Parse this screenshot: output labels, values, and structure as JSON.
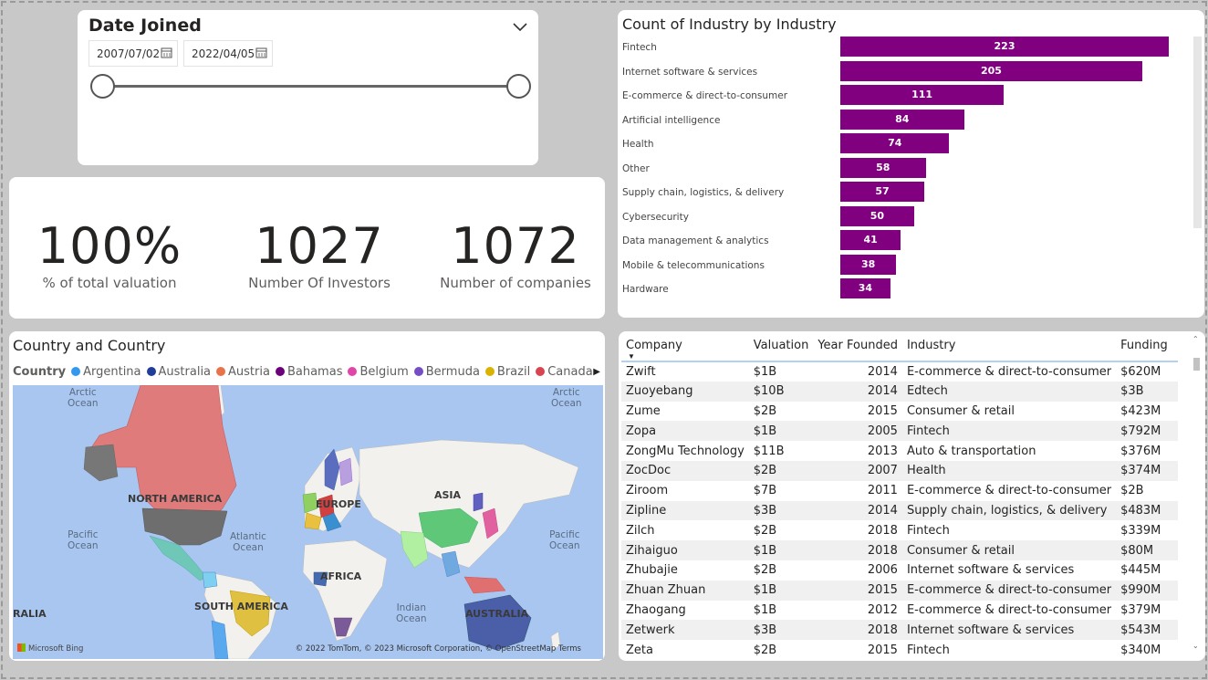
{
  "slicer": {
    "title": "Date Joined",
    "start_date": "2007/07/02",
    "end_date": "2022/04/05"
  },
  "kpis": [
    {
      "value": "100%",
      "label": "% of total valuation"
    },
    {
      "value": "1027",
      "label": "Number Of Investors"
    },
    {
      "value": "1072",
      "label": "Number of companies"
    }
  ],
  "chart_data": {
    "type": "bar",
    "orientation": "horizontal",
    "title": "Count of Industry by Industry",
    "categories": [
      "Fintech",
      "Internet software & services",
      "E-commerce & direct-to-consumer",
      "Artificial intelligence",
      "Health",
      "Other",
      "Supply chain, logistics, & delivery",
      "Cybersecurity",
      "Data management & analytics",
      "Mobile & telecommunications",
      "Hardware"
    ],
    "values": [
      223,
      205,
      111,
      84,
      74,
      58,
      57,
      50,
      41,
      38,
      34
    ],
    "color": "#800080",
    "data_labels": true
  },
  "map": {
    "title": "Country and Country",
    "legend_title": "Country",
    "legend": [
      {
        "name": "Argentina",
        "color": "#3399ee"
      },
      {
        "name": "Australia",
        "color": "#1f3d99"
      },
      {
        "name": "Austria",
        "color": "#e8734a"
      },
      {
        "name": "Bahamas",
        "color": "#6b007b"
      },
      {
        "name": "Belgium",
        "color": "#e046a8"
      },
      {
        "name": "Bermuda",
        "color": "#744ec2"
      },
      {
        "name": "Brazil",
        "color": "#d9b300"
      },
      {
        "name": "Canada",
        "color": "#d64550"
      }
    ],
    "region_labels": [
      "NORTH AMERICA",
      "EUROPE",
      "ASIA",
      "AFRICA",
      "SOUTH AMERICA",
      "AUSTRALIA",
      "RALIA"
    ],
    "ocean_labels": [
      "Arctic\nOcean",
      "Arctic\nOcean",
      "Pacific\nOcean",
      "Atlantic\nOcean",
      "Pacific\nOcean",
      "Indian\nOcean"
    ],
    "attribution": "© 2022 TomTom, © 2023 Microsoft Corporation, © OpenStreetMap  Terms",
    "provider": "Microsoft Bing"
  },
  "table": {
    "columns": [
      "Company",
      "Valuation",
      "Year Founded",
      "Industry",
      "Funding"
    ],
    "rows": [
      [
        "Zwift",
        "$1B",
        "2014",
        "E-commerce & direct-to-consumer",
        "$620M"
      ],
      [
        "Zuoyebang",
        "$10B",
        "2014",
        "Edtech",
        "$3B"
      ],
      [
        "Zume",
        "$2B",
        "2015",
        "Consumer & retail",
        "$423M"
      ],
      [
        "Zopa",
        "$1B",
        "2005",
        "Fintech",
        "$792M"
      ],
      [
        "ZongMu Technology",
        "$11B",
        "2013",
        "Auto & transportation",
        "$376M"
      ],
      [
        "ZocDoc",
        "$2B",
        "2007",
        "Health",
        "$374M"
      ],
      [
        "Ziroom",
        "$7B",
        "2011",
        "E-commerce & direct-to-consumer",
        "$2B"
      ],
      [
        "Zipline",
        "$3B",
        "2014",
        "Supply chain, logistics, & delivery",
        "$483M"
      ],
      [
        "Zilch",
        "$2B",
        "2018",
        "Fintech",
        "$339M"
      ],
      [
        "Zihaiguo",
        "$1B",
        "2018",
        "Consumer & retail",
        "$80M"
      ],
      [
        "Zhubajie",
        "$2B",
        "2006",
        "Internet software & services",
        "$445M"
      ],
      [
        "Zhuan Zhuan",
        "$1B",
        "2015",
        "E-commerce & direct-to-consumer",
        "$990M"
      ],
      [
        "Zhaogang",
        "$1B",
        "2012",
        "E-commerce & direct-to-consumer",
        "$379M"
      ],
      [
        "Zetwerk",
        "$3B",
        "2018",
        "Internet software & services",
        "$543M"
      ],
      [
        "Zeta",
        "$2B",
        "2015",
        "Fintech",
        "$340M"
      ]
    ]
  }
}
